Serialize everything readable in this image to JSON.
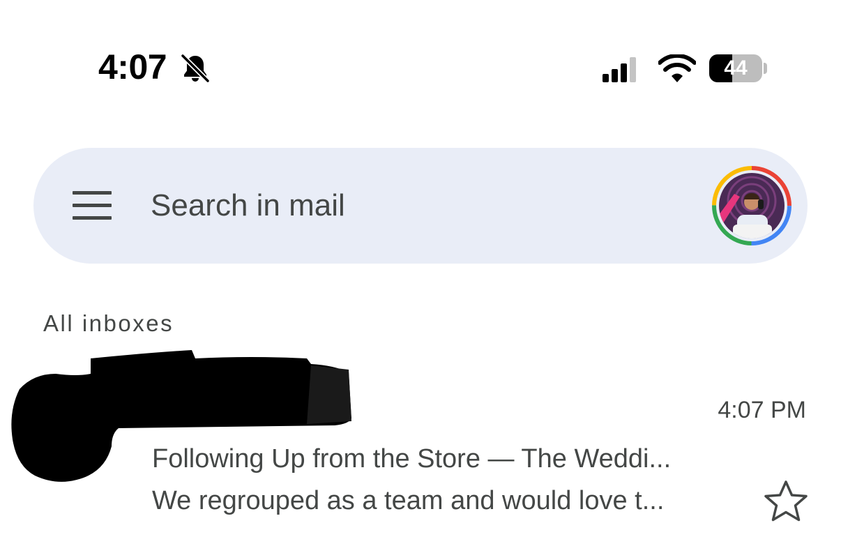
{
  "status_bar": {
    "time": "4:07",
    "silent_icon": "bell-slash-icon",
    "signal_icon": "cellular-signal-icon",
    "wifi_icon": "wifi-icon",
    "battery_percent": "44",
    "battery_level": 0.44
  },
  "search_bar": {
    "menu_icon": "hamburger-menu-icon",
    "placeholder": "Search in mail",
    "value": "",
    "account_icon": "account-avatar"
  },
  "inbox": {
    "label": "All inboxes",
    "emails": [
      {
        "sender": "",
        "time": "4:07 PM",
        "subject": "Following Up from the Store — The Weddi...",
        "snippet": "We regrouped as a team and would love t...",
        "star_icon": "star-outline-icon",
        "starred": false
      }
    ]
  },
  "colors": {
    "search_bar_bg": "#e9edf7",
    "text_secondary": "#444746",
    "ring_red": "#ea4335",
    "ring_blue": "#4285f4",
    "ring_green": "#34a853",
    "ring_yellow": "#fbbc04"
  }
}
